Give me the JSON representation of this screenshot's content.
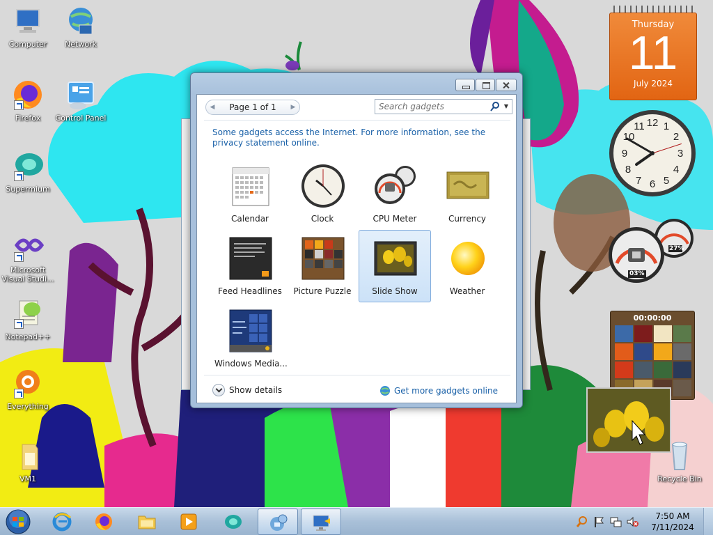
{
  "desktop": {
    "icons": [
      {
        "label": "Computer"
      },
      {
        "label": "Network"
      },
      {
        "label": "Firefox"
      },
      {
        "label": "Control Panel"
      },
      {
        "label": "Supermium"
      },
      {
        "label": "Microsoft Visual Studi..."
      },
      {
        "label": "Notepad++"
      },
      {
        "label": "Everything"
      },
      {
        "label": "VM1"
      },
      {
        "label": "Recycle Bin"
      }
    ]
  },
  "gadgets_on_desktop": {
    "calendar": {
      "day": "Thursday",
      "date": "11",
      "month": "July 2024"
    },
    "clock": {
      "hour": 7,
      "minute": 50,
      "second": 12
    },
    "cpu_meter": {
      "cpu": "03%",
      "memory": "27%"
    },
    "picture_puzzle": {
      "timer": "00:00:00"
    }
  },
  "gadget_window": {
    "title_buttons": [
      "minimize",
      "restore",
      "close"
    ],
    "pager": {
      "label": "Page 1 of 1"
    },
    "search": {
      "placeholder": "Search gadgets"
    },
    "info_text": "Some gadgets access the Internet.  For more information, see the privacy statement online.",
    "gadgets": [
      {
        "label": "Calendar",
        "icon": "calendar-gadget-icon",
        "selected": false
      },
      {
        "label": "Clock",
        "icon": "clock-gadget-icon",
        "selected": false
      },
      {
        "label": "CPU Meter",
        "icon": "cpu-meter-gadget-icon",
        "selected": false
      },
      {
        "label": "Currency",
        "icon": "currency-gadget-icon",
        "selected": false
      },
      {
        "label": "Feed Headlines",
        "icon": "feed-headlines-gadget-icon",
        "selected": false
      },
      {
        "label": "Picture Puzzle",
        "icon": "picture-puzzle-gadget-icon",
        "selected": false
      },
      {
        "label": "Slide Show",
        "icon": "slide-show-gadget-icon",
        "selected": true
      },
      {
        "label": "Weather",
        "icon": "weather-gadget-icon",
        "selected": false
      },
      {
        "label": "Windows Media...",
        "icon": "windows-media-gadget-icon",
        "selected": false
      }
    ],
    "show_details": "Show details",
    "more_gadgets": "Get more gadgets online"
  },
  "taskbar": {
    "pinned": [
      {
        "name": "internet-explorer"
      },
      {
        "name": "firefox"
      },
      {
        "name": "file-explorer"
      },
      {
        "name": "media-player"
      },
      {
        "name": "supermium"
      },
      {
        "name": "gadgets",
        "active": true
      },
      {
        "name": "remote-desktop",
        "active": true
      }
    ],
    "clock": {
      "time": "7:50 AM",
      "date": "7/11/2024"
    }
  },
  "colors": {
    "link": "#1a61a8",
    "calendar_orange": "#e8711f",
    "selection": "#cce2f8"
  }
}
